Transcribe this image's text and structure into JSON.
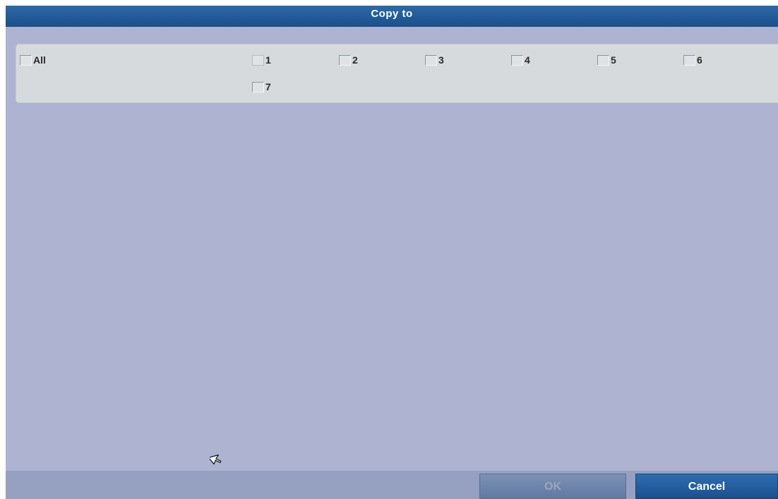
{
  "dialog": {
    "title": "Copy to"
  },
  "channels": {
    "all_label": "All",
    "items": [
      {
        "label": "1",
        "checked": false,
        "disabled": true
      },
      {
        "label": "2",
        "checked": false,
        "disabled": false
      },
      {
        "label": "3",
        "checked": false,
        "disabled": false
      },
      {
        "label": "4",
        "checked": false,
        "disabled": false
      },
      {
        "label": "5",
        "checked": false,
        "disabled": false
      },
      {
        "label": "6",
        "checked": false,
        "disabled": false
      },
      {
        "label": "7",
        "checked": false,
        "disabled": false
      }
    ]
  },
  "footer": {
    "ok_label": "OK",
    "cancel_label": "Cancel"
  },
  "icons": {
    "cursor": "mouse-pointer-icon"
  },
  "colors": {
    "title_bar": "#1f5a96",
    "background": "#adb3d1",
    "panel": "#d6dadc",
    "cancel_button": "#2363a5",
    "ok_button_disabled": "#6c84ab"
  }
}
